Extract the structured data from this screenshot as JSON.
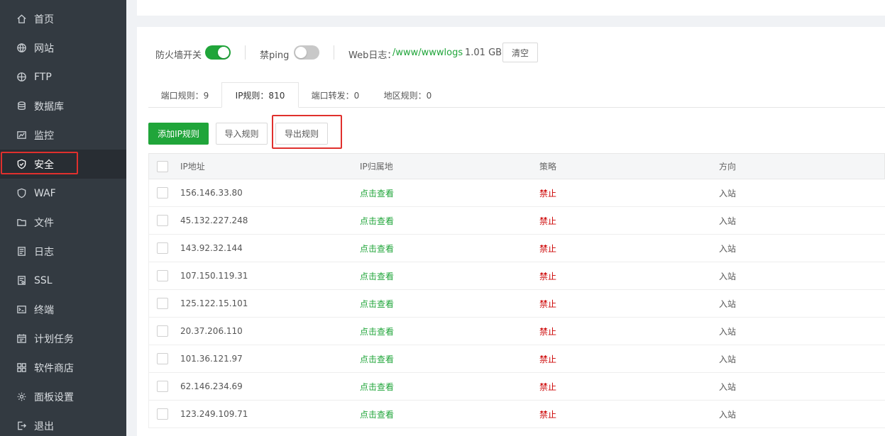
{
  "sidebar": {
    "items": [
      {
        "label": "首页",
        "icon": "home-icon"
      },
      {
        "label": "网站",
        "icon": "globe-icon"
      },
      {
        "label": "FTP",
        "icon": "ftp-globe-icon"
      },
      {
        "label": "数据库",
        "icon": "database-icon"
      },
      {
        "label": "监控",
        "icon": "monitor-chart-icon"
      },
      {
        "label": "安全",
        "icon": "shield-check-icon"
      },
      {
        "label": "WAF",
        "icon": "waf-shield-icon"
      },
      {
        "label": "文件",
        "icon": "folder-icon"
      },
      {
        "label": "日志",
        "icon": "log-document-icon"
      },
      {
        "label": "SSL",
        "icon": "ssl-certificate-icon"
      },
      {
        "label": "终端",
        "icon": "terminal-icon"
      },
      {
        "label": "计划任务",
        "icon": "calendar-task-icon"
      },
      {
        "label": "软件商店",
        "icon": "app-store-grid-icon"
      },
      {
        "label": "面板设置",
        "icon": "gear-icon"
      },
      {
        "label": "退出",
        "icon": "logout-icon"
      }
    ],
    "active": "安全"
  },
  "toolbar": {
    "firewall_label": "防火墙开关",
    "firewall_on": true,
    "ping_label": "禁ping",
    "ping_on": false,
    "web_log_label": "Web日志：",
    "web_log_path": "/www/wwwlogs",
    "web_log_size": "1.01 GB",
    "clear_button": "清空"
  },
  "subtabs": [
    {
      "label": "端口规则：9"
    },
    {
      "label": "IP规则：810"
    },
    {
      "label": "端口转发：0"
    },
    {
      "label": "地区规则：0"
    }
  ],
  "actions": {
    "add_ip_rule": "添加IP规则",
    "import_rules": "导入规则",
    "export_rules": "导出规则"
  },
  "table": {
    "headers": [
      "IP地址",
      "IP归属地",
      "策略",
      "方向"
    ],
    "rows": [
      {
        "ip": "156.146.33.80",
        "location": "点击查看",
        "policy": "禁止",
        "direction": "入站"
      },
      {
        "ip": "45.132.227.248",
        "location": "点击查看",
        "policy": "禁止",
        "direction": "入站"
      },
      {
        "ip": "143.92.32.144",
        "location": "点击查看",
        "policy": "禁止",
        "direction": "入站"
      },
      {
        "ip": "107.150.119.31",
        "location": "点击查看",
        "policy": "禁止",
        "direction": "入站"
      },
      {
        "ip": "125.122.15.101",
        "location": "点击查看",
        "policy": "禁止",
        "direction": "入站"
      },
      {
        "ip": "20.37.206.110",
        "location": "点击查看",
        "policy": "禁止",
        "direction": "入站"
      },
      {
        "ip": "101.36.121.97",
        "location": "点击查看",
        "policy": "禁止",
        "direction": "入站"
      },
      {
        "ip": "62.146.234.69",
        "location": "点击查看",
        "policy": "禁止",
        "direction": "入站"
      },
      {
        "ip": "123.249.109.71",
        "location": "点击查看",
        "policy": "禁止",
        "direction": "入站"
      }
    ]
  },
  "colors": {
    "sidebar_bg": "#333a41",
    "accent_green": "#20a53a",
    "deny_red": "#cc0000",
    "highlight_red": "#e0302d"
  }
}
